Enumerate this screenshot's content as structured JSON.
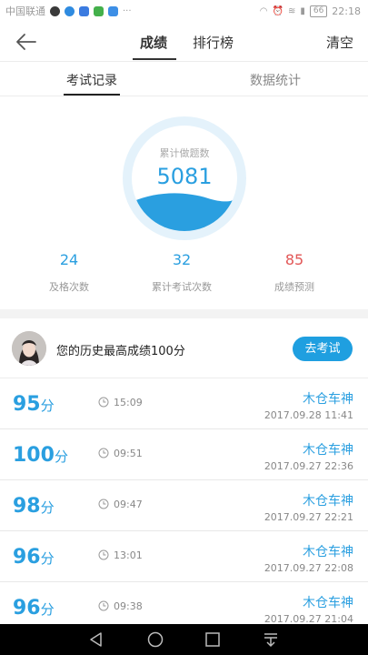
{
  "status_bar": {
    "carrier": "中国联通",
    "battery": "66",
    "time": "22:18"
  },
  "nav": {
    "tabs": [
      {
        "label": "成绩",
        "active": true
      },
      {
        "label": "排行榜",
        "active": false
      }
    ],
    "clear_label": "清空"
  },
  "sub_tabs": [
    {
      "label": "考试记录",
      "active": true
    },
    {
      "label": "数据统计",
      "active": false
    }
  ],
  "summary": {
    "gauge_label": "累计做题数",
    "gauge_value": "5081",
    "stats": [
      {
        "value": "24",
        "label": "及格次数"
      },
      {
        "value": "32",
        "label": "累计考试次数"
      },
      {
        "value": "85",
        "label": "成绩预测"
      }
    ]
  },
  "best": {
    "text": "您的历史最高成绩100分",
    "button_label": "去考试"
  },
  "records": [
    {
      "score": "95",
      "unit": "分",
      "time": "15:09",
      "name": "木仓车神",
      "date": "2017.09.28  11:41"
    },
    {
      "score": "100",
      "unit": "分",
      "time": "09:51",
      "name": "木仓车神",
      "date": "2017.09.27  22:36"
    },
    {
      "score": "98",
      "unit": "分",
      "time": "09:47",
      "name": "木仓车神",
      "date": "2017.09.27  22:21"
    },
    {
      "score": "96",
      "unit": "分",
      "time": "13:01",
      "name": "木仓车神",
      "date": "2017.09.27  22:08"
    },
    {
      "score": "96",
      "unit": "分",
      "time": "09:38",
      "name": "木仓车神",
      "date": "2017.09.27  21:04"
    }
  ],
  "colors": {
    "accent": "#2a9fe0",
    "button": "#1f9fe0",
    "prediction": "#e25757"
  },
  "icons": {
    "back": "arrow-left-icon",
    "clock": "clock-icon"
  }
}
